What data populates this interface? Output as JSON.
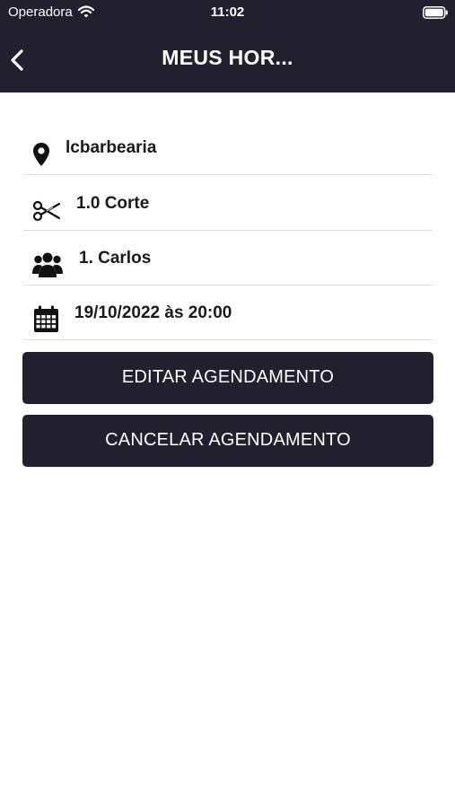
{
  "status_bar": {
    "carrier": "Operadora",
    "time": "11:02"
  },
  "header": {
    "title": "MEUS HOR..."
  },
  "details": [
    {
      "icon": "map-pin-icon",
      "label": "lcbarbearia"
    },
    {
      "icon": "scissors-icon",
      "label": "1.0 Corte"
    },
    {
      "icon": "users-icon",
      "label": "1. Carlos"
    },
    {
      "icon": "calendar-icon",
      "label": "19/10/2022 às 20:00"
    }
  ],
  "actions": {
    "edit_label": "EDITAR AGENDAMENTO",
    "cancel_label": "CANCELAR AGENDAMENTO"
  },
  "colors": {
    "primary": "#221f2e",
    "background": "#ffffff",
    "divider": "#dcdcdc"
  }
}
